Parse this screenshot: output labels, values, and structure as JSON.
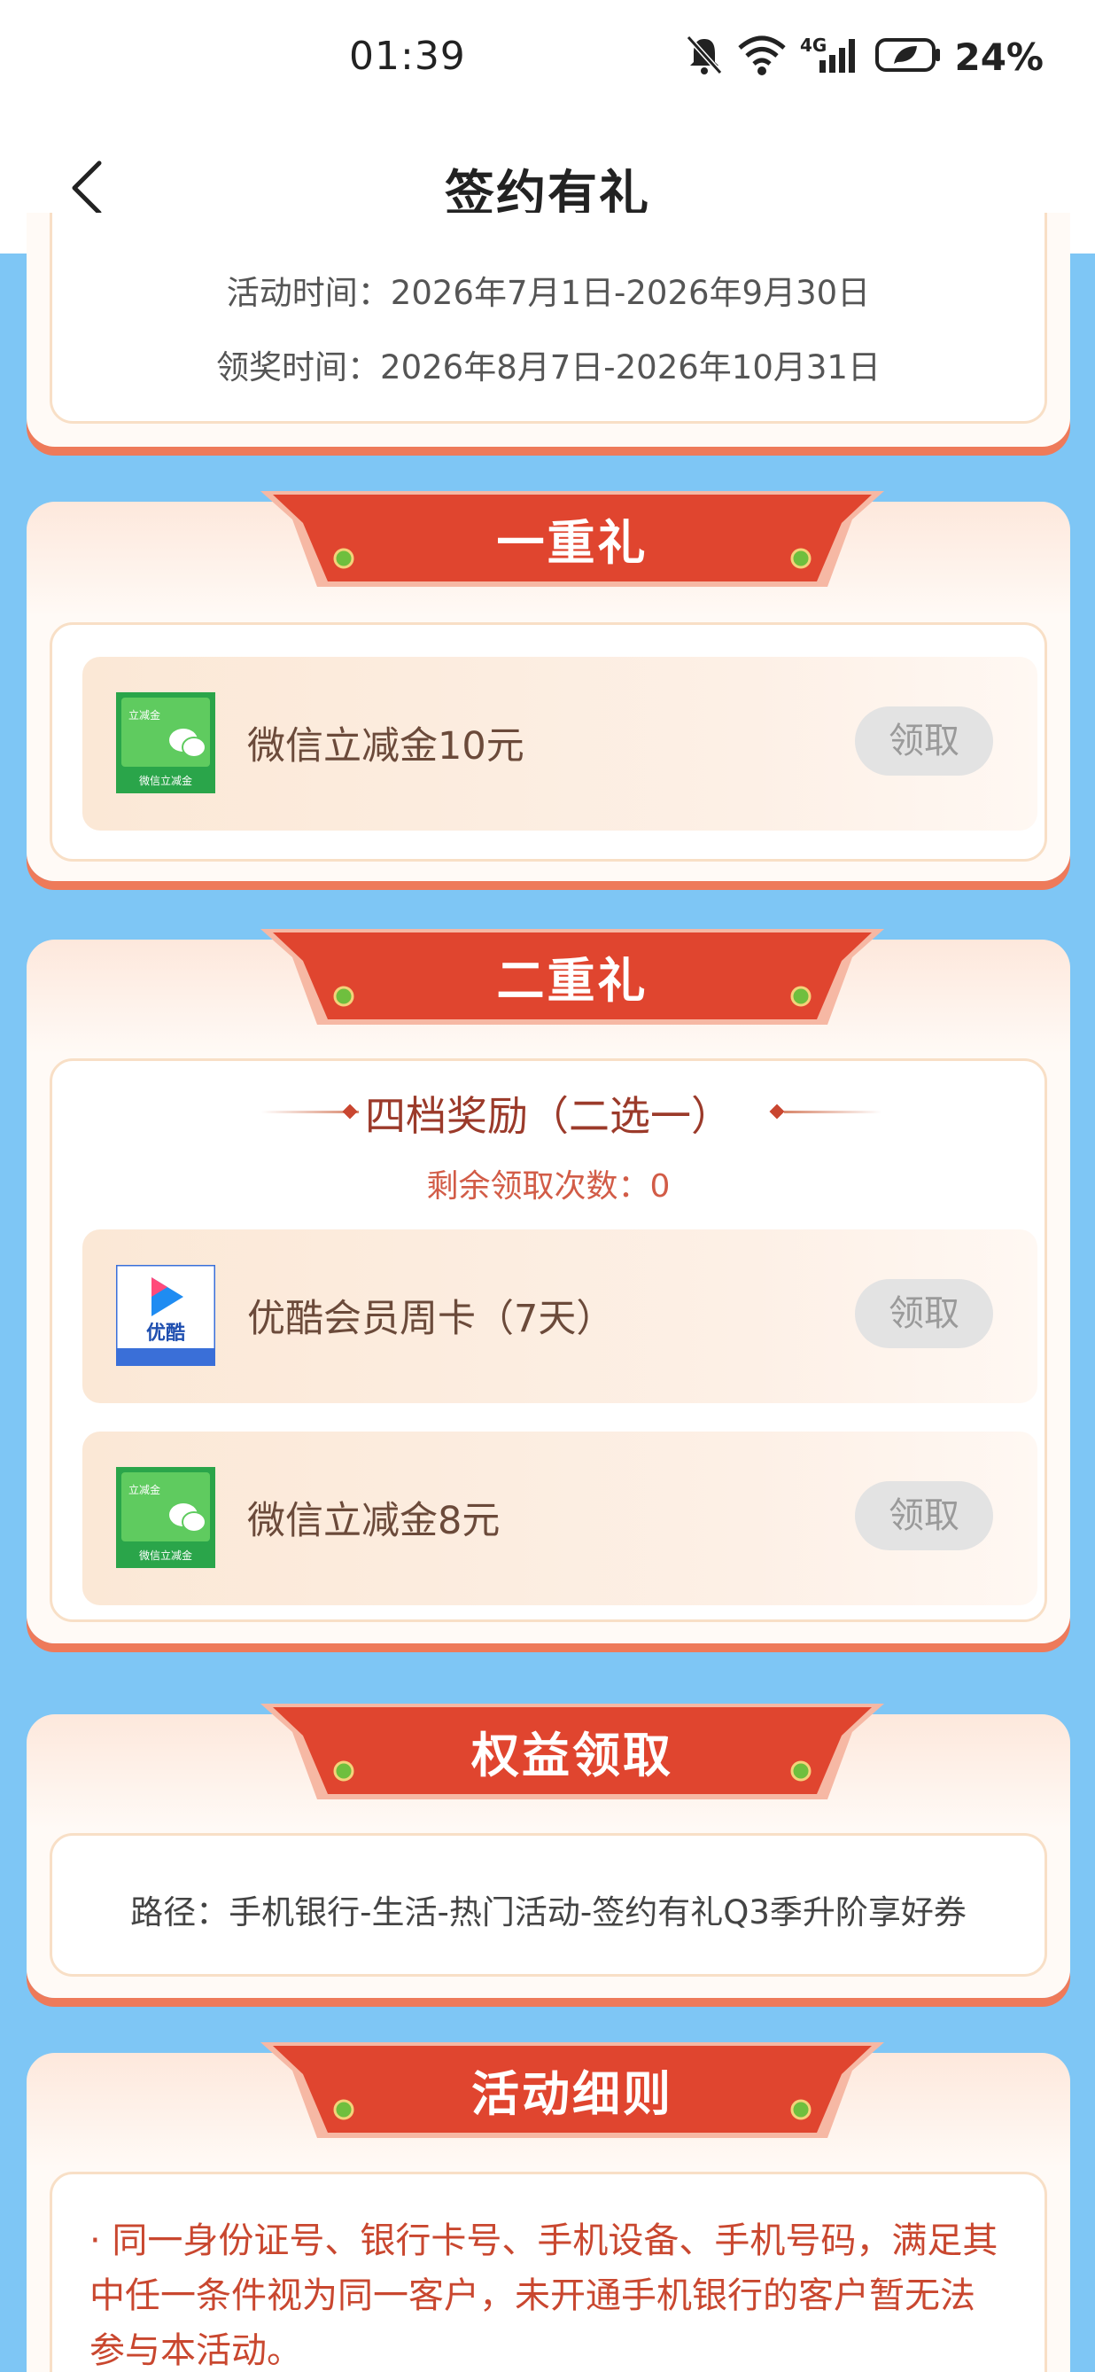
{
  "status_bar": {
    "time": "01:39",
    "battery": "24%",
    "network": "4G",
    "icons": [
      "mute-bell-icon",
      "wifi-icon",
      "signal-icon",
      "battery-icon"
    ]
  },
  "nav": {
    "title": "签约有礼",
    "back_icon": "chevron-left-icon"
  },
  "info": {
    "activity_time": "活动时间：2026年7月1日-2026年9月30日",
    "claim_time": "领奖时间：2026年8月7日-2026年10月31日"
  },
  "tier1": {
    "title": "一重礼",
    "prizes": [
      {
        "name": "微信立减金10元",
        "button": "领取",
        "icon": "wechat-coupon-icon"
      }
    ]
  },
  "tier2": {
    "title": "二重礼",
    "subtitle": "四档奖励（二选一）",
    "remaining": "剩余领取次数：0",
    "prizes": [
      {
        "name": "优酷会员周卡（7天）",
        "button": "领取",
        "icon": "youku-icon"
      },
      {
        "name": "微信立减金8元",
        "button": "领取",
        "icon": "wechat-coupon-icon"
      }
    ]
  },
  "benefits": {
    "title": "权益领取",
    "path": "路径：手机银行-生活-热门活动-签约有礼Q3季升阶享好券"
  },
  "rules": {
    "title": "活动细则",
    "text": "· 同一身份证号、银行卡号、手机设备、手机号码，满足其中任一条件视为同一客户，未开通手机银行的客户暂无法参与本活动。"
  },
  "thumb_text": {
    "wechat_tag": "立减金",
    "wechat_caption": "微信立减金",
    "youku_name": "优酷"
  },
  "colors": {
    "background": "#7ec6f5",
    "ribbon": "#e0452f",
    "accent_text": "#c9472f",
    "button_disabled": "#e3e3e3"
  }
}
